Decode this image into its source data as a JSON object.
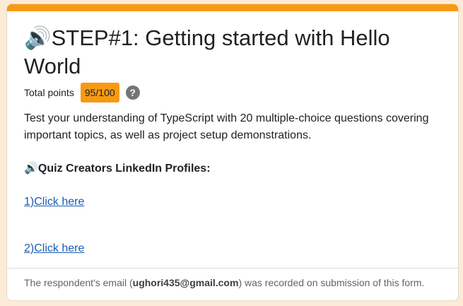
{
  "form": {
    "title_emoji": "🔊",
    "title": "STEP#1: Getting started with Hello World",
    "points_label": "Total points",
    "points_value": "95/100",
    "help_glyph": "?",
    "description": "Test your understanding of TypeScript with 20 multiple-choice questions covering important topics, as well as project setup demonstrations.",
    "creators_emoji": "🔊",
    "creators_heading": "Quiz Creators LinkedIn Profiles:",
    "links": [
      {
        "label": "1)Click here"
      },
      {
        "label": "2)Click here"
      }
    ]
  },
  "footer": {
    "prefix": "The respondent's email (",
    "email": "ughori435@gmail.com",
    "suffix": ") was recorded on submission of this form."
  },
  "colors": {
    "accent": "#f79a12",
    "link": "#1a5cb0",
    "background": "#fcebd5"
  },
  "icons": {
    "speaker": "speaker-icon",
    "help": "help-icon"
  }
}
